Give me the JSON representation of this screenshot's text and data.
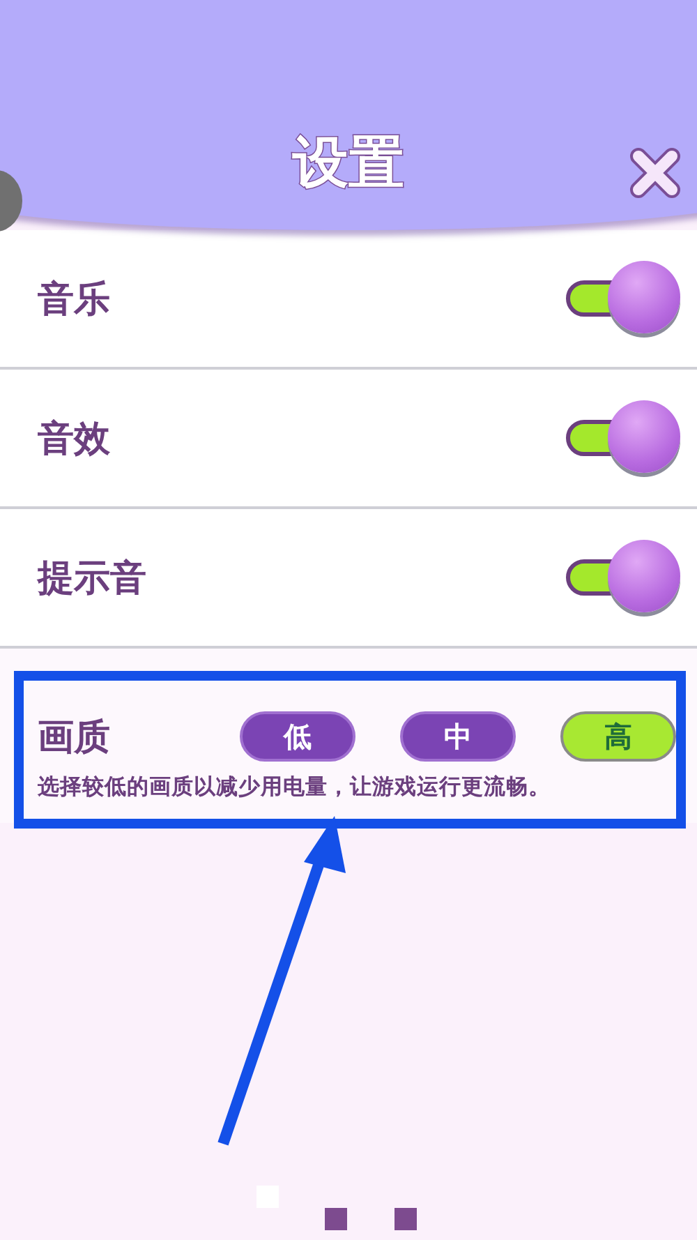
{
  "header": {
    "title": "设置"
  },
  "toggles": [
    {
      "label": "音乐",
      "on": true
    },
    {
      "label": "音效",
      "on": true
    },
    {
      "label": "提示音",
      "on": true
    }
  ],
  "quality": {
    "label": "画质",
    "options": [
      {
        "label": "低",
        "selected": false
      },
      {
        "label": "中",
        "selected": false
      },
      {
        "label": "高",
        "selected": true
      }
    ],
    "hint": "选择较低的画质以减少用电量，让游戏运行更流畅。"
  }
}
